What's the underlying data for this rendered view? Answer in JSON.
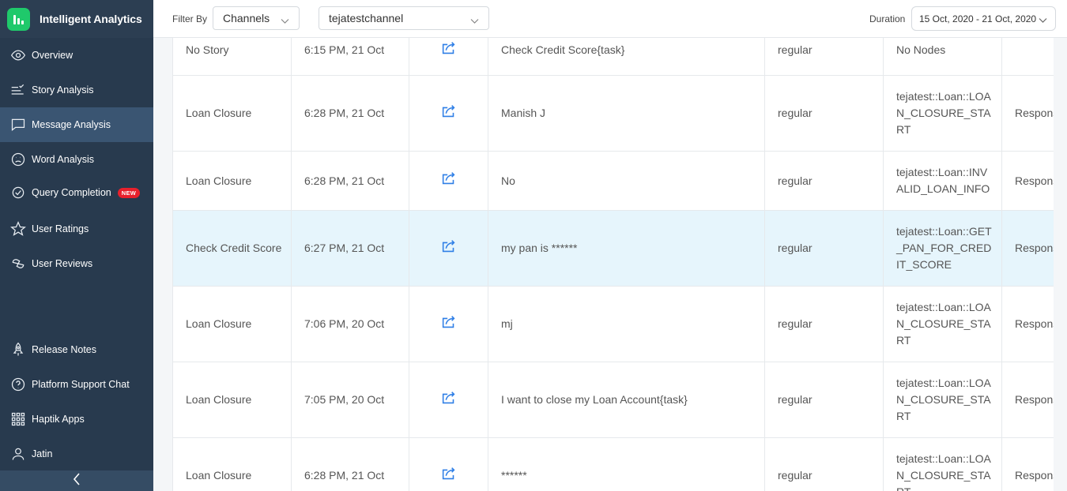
{
  "app": {
    "title": "Intelligent Analytics"
  },
  "colors": {
    "sidebar": "#283a4e",
    "active": "#3a5572",
    "brand": "#1fc96b",
    "accent": "#2f7fe6",
    "highlight": "#e6f5fc",
    "badge": "#e8202c"
  },
  "sidebar": {
    "items": [
      {
        "label": "Overview",
        "icon": "eye-icon"
      },
      {
        "label": "Story Analysis",
        "icon": "story-analysis-icon"
      },
      {
        "label": "Message Analysis",
        "icon": "message-icon",
        "active": true
      },
      {
        "label": "Word Analysis",
        "icon": "sad-face-icon"
      },
      {
        "label": "Query Completion",
        "icon": "check-circle-icon",
        "badge": "NEW"
      },
      {
        "label": "User Ratings",
        "icon": "star-icon"
      },
      {
        "label": "User Reviews",
        "icon": "reviews-icon"
      }
    ],
    "bottom": [
      {
        "label": "Release Notes",
        "icon": "rocket-icon"
      },
      {
        "label": "Platform Support Chat",
        "icon": "help-icon"
      },
      {
        "label": "Haptik Apps",
        "icon": "apps-grid-icon"
      },
      {
        "label": "Jatin",
        "icon": "user-icon"
      }
    ]
  },
  "header": {
    "filter_label": "Filter By",
    "filter_type": "Channels",
    "channel": "tejatestchannel",
    "duration_label": "Duration",
    "duration_value": "15 Oct, 2020 - 21 Oct, 2020"
  },
  "table": {
    "rows": [
      {
        "story": "No Story",
        "time": "6:15 PM, 21 Oct",
        "message": "Check Credit Score{task}",
        "type": "regular",
        "node": "No Nodes",
        "response": ""
      },
      {
        "story": "Loan Closure",
        "time": "6:28 PM, 21 Oct",
        "message": "Manish J",
        "type": "regular",
        "node": "tejatest::Loan::LOAN_CLOSURE_START",
        "response": "Respons"
      },
      {
        "story": "Loan Closure",
        "time": "6:28 PM, 21 Oct",
        "message": "No",
        "type": "regular",
        "node": "tejatest::Loan::INVALID_LOAN_INFO",
        "response": "Respons"
      },
      {
        "story": "Check Credit Score",
        "time": "6:27 PM, 21 Oct",
        "message": "my pan is ******",
        "type": "regular",
        "node": "tejatest::Loan::GET_PAN_FOR_CREDIT_SCORE",
        "response": "Respons",
        "highlight": true
      },
      {
        "story": "Loan Closure",
        "time": "7:06 PM, 20 Oct",
        "message": "mj",
        "type": "regular",
        "node": "tejatest::Loan::LOAN_CLOSURE_START",
        "response": "Respons"
      },
      {
        "story": "Loan Closure",
        "time": "7:05 PM, 20 Oct",
        "message": "I want to close my Loan Account{task}",
        "type": "regular",
        "node": "tejatest::Loan::LOAN_CLOSURE_START",
        "response": "Respons"
      },
      {
        "story": "Loan Closure",
        "time": "6:28 PM, 21 Oct",
        "message": "******",
        "type": "regular",
        "node": "tejatest::Loan::LOAN_CLOSURE_START",
        "response": "Respons"
      }
    ]
  }
}
